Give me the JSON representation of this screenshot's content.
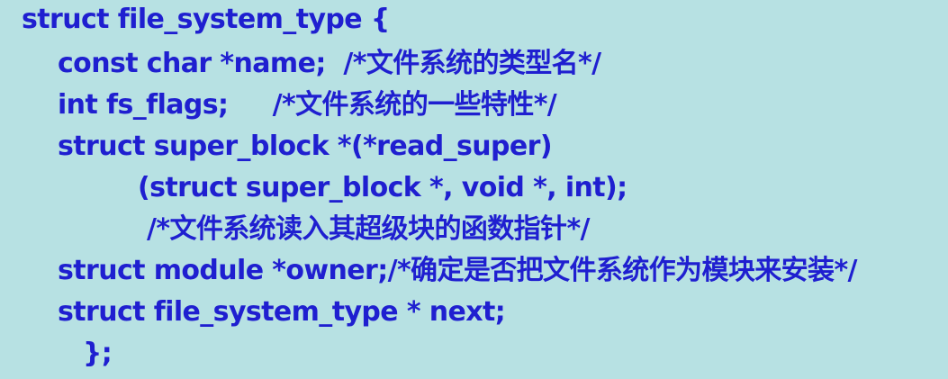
{
  "code": {
    "lines": [
      "struct file_system_type {",
      "const char *name;  /*文件系统的类型名*/",
      "int fs_flags;     /*文件系统的一些特性*/",
      "struct super_block *(*read_super)",
      "(struct super_block *, void *, int);",
      "/*文件系统读入其超级块的函数指针*/",
      "struct module *owner;/*确定是否把文件系统作为模块来安装*/",
      "struct file_system_type * next;",
      "};"
    ]
  },
  "colors": {
    "background": "#b7e1e3",
    "text": "#1f1fd0"
  }
}
